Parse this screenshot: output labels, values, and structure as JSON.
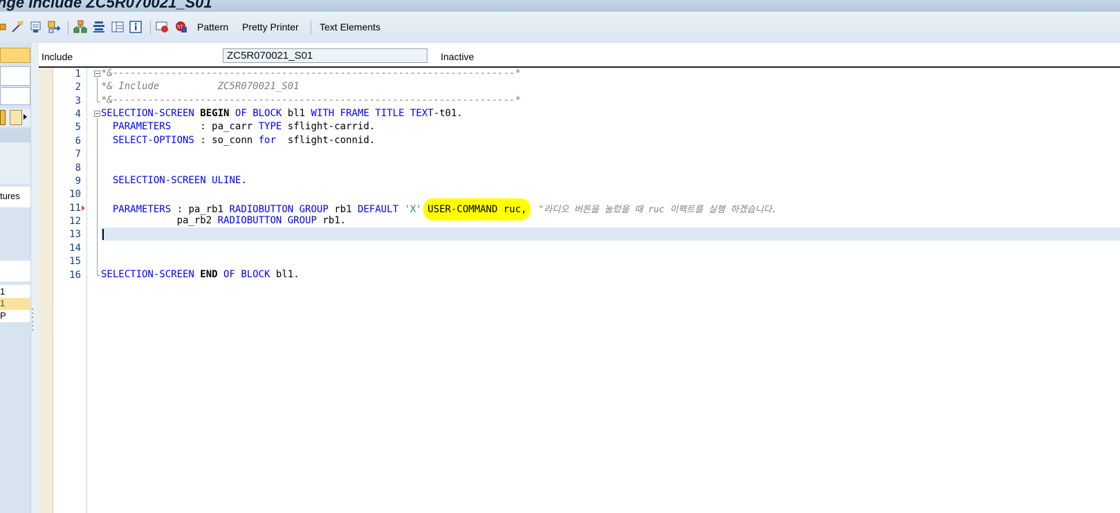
{
  "window": {
    "title": "nge Include ZC5R070021_S01"
  },
  "toolbar": {
    "buttons": [
      {
        "label": "Pattern"
      },
      {
        "label": "Pretty Printer"
      },
      {
        "label": "Text Elements"
      }
    ]
  },
  "left_panel": {
    "fragments": [
      "tures",
      "1",
      "1",
      "P"
    ]
  },
  "header": {
    "label": "Include",
    "value": "ZC5R070021_S01",
    "status": "Inactive"
  },
  "editor": {
    "line_numbers": [
      "1",
      "2",
      "3",
      "4",
      "5",
      "6",
      "7",
      "8",
      "9",
      "10",
      "11",
      "12",
      "13",
      "14",
      "15",
      "16"
    ],
    "lines": {
      "l1": "*&---------------------------------------------------------------------*",
      "l2": "*& Include          ZC5R070021_S01",
      "l3": "*&---------------------------------------------------------------------*",
      "l4": {
        "kw1": "SELECTION-SCREEN",
        "kb1": "BEGIN",
        "kw2": "OF",
        "kw3": "BLOCK",
        "id1": "bl1",
        "kw4": "WITH",
        "kw5": "FRAME",
        "kw6": "TITLE",
        "kw7": "TEXT",
        "id2": "-t01."
      },
      "l5": {
        "kw1": "PARAMETERS",
        "id1": "     : pa_carr",
        "kw2": "TYPE",
        "id2": "sflight-carrid."
      },
      "l6": {
        "kw1": "SELECT-OPTIONS",
        "id1": ": so_conn",
        "kw2": "for",
        "id2": " sflight-connid."
      },
      "l9": {
        "kw1": "SELECTION-SCREEN",
        "kw2": "ULINE",
        "id1": "."
      },
      "l11": {
        "kw1": "PARAMETERS",
        "id1": ": pa_rb1",
        "kw2": "RADIOBUTTON",
        "kw3": "GROUP",
        "id2": "rb1",
        "kw4": "DEFAULT",
        "st1": "'X'",
        "hl1": "USER-COMMAND ruc,",
        "cm1": "\"라디오 버튼을 눌렀을 때 ruc 이펙트를 실행 하겠습니다."
      },
      "l12": {
        "id1": "pa_rb2",
        "kw1": "RADIOBUTTON",
        "kw2": "GROUP",
        "id2": "rb1."
      },
      "l16": {
        "kw1": "SELECTION-SCREEN",
        "kb1": "END",
        "kw2": "OF",
        "kw3": "BLOCK",
        "id1": "bl1."
      }
    }
  },
  "colors": {
    "keyword": "#0000ff",
    "comment": "#7f7f7f",
    "string": "#2e8b57",
    "highlight": "#ffff00",
    "current_line": "#dce8f3"
  }
}
